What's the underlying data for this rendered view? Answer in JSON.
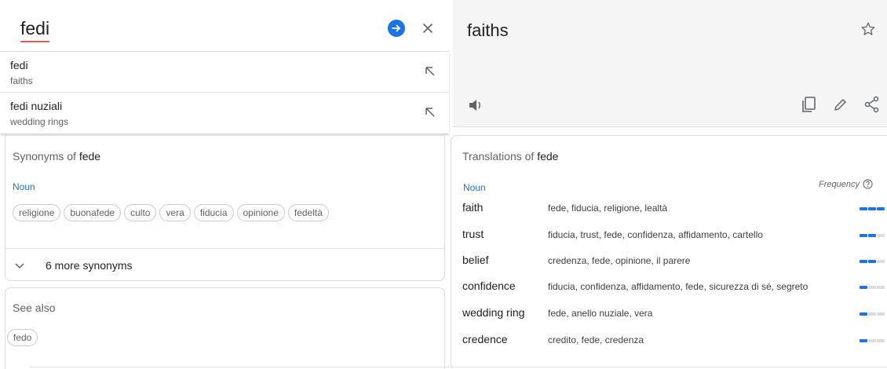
{
  "search": {
    "query": "fedi"
  },
  "suggestions": [
    {
      "term": "fedi",
      "translation": "faiths"
    },
    {
      "term": "fedi nuziali",
      "translation": "wedding rings"
    }
  ],
  "synonyms": {
    "title_prefix": "Synonyms of",
    "word": "fede",
    "pos": "Noun",
    "chips": [
      "religione",
      "buonafede",
      "culto",
      "vera",
      "fiducia",
      "opinione",
      "fedeltà"
    ],
    "more_label": "6 more synonyms"
  },
  "see_also": {
    "title": "See also",
    "chips": [
      "fedo"
    ]
  },
  "result": {
    "text": "faiths"
  },
  "translations": {
    "title_prefix": "Translations of",
    "word": "fede",
    "pos": "Noun",
    "frequency_label": "Frequency",
    "rows": [
      {
        "word": "faith",
        "synonyms": "fede, fiducia, religione, lealtà",
        "frequency": 3
      },
      {
        "word": "trust",
        "synonyms": "fiducia, trust, fede, confidenza, affidamento, cartello",
        "frequency": 2
      },
      {
        "word": "belief",
        "synonyms": "credenza, fede, opinione, il parere",
        "frequency": 2
      },
      {
        "word": "confidence",
        "synonyms": "fiducia, confidenza, affidamento, fede, sicurezza di sé, segreto",
        "frequency": 1
      },
      {
        "word": "wedding ring",
        "synonyms": "fede, anello nuziale, vera",
        "frequency": 1
      },
      {
        "word": "credence",
        "synonyms": "credito, fede, credenza",
        "frequency": 1
      }
    ]
  },
  "colors": {
    "accent": "#1a73e8",
    "result_bg": "#f5f5f5",
    "spell_underline": "#e05a5a"
  }
}
